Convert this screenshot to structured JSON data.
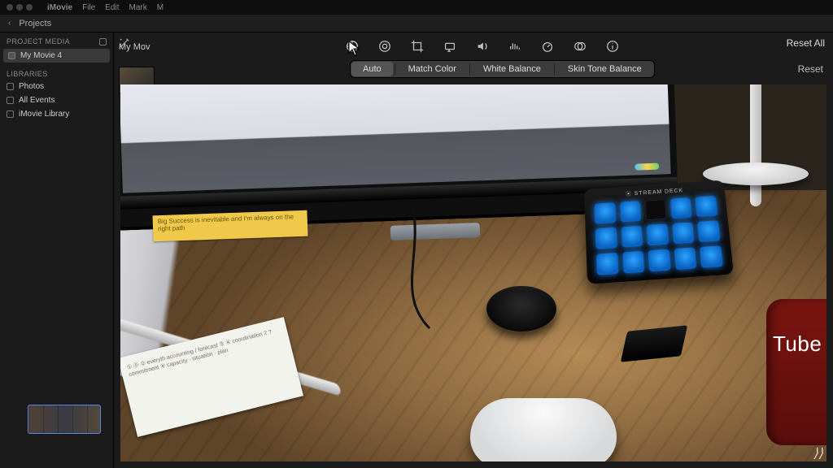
{
  "menubar": {
    "app": "iMovie",
    "items": [
      "File",
      "Edit",
      "Mark",
      "M"
    ]
  },
  "topbar": {
    "back": "‹",
    "projects": "Projects"
  },
  "library": {
    "projectMediaHeader": "PROJECT MEDIA",
    "projectName": "My Movie 4",
    "librariesHeader": "LIBRARIES",
    "photos": "Photos",
    "allEvents": "All Events",
    "imovieLibrary": "iMovie Library"
  },
  "browser": {
    "label": "My Mov"
  },
  "ccToolbar": {
    "icons": [
      "color-balance",
      "color-wheel",
      "crop",
      "stabilize",
      "audio",
      "eq",
      "speed",
      "effects",
      "info"
    ]
  },
  "segbar": {
    "auto": "Auto",
    "matchColor": "Match Color",
    "whiteBalance": "White Balance",
    "skinTone": "Skin Tone Balance"
  },
  "resetAll": "Reset All",
  "reset": "Reset",
  "scene": {
    "sticky": "Big Success is inevitable and\nI'm always on the right path",
    "notecard": "① ⓪ ② everyth\n   accounting / forecast\n⑤  ④  coordination\n   2 ?  commitment\n④ capacity · situation · plan",
    "streamdeckTitle": "⦿ STREAM DECK",
    "mugText": "Tube"
  },
  "cornerGlyph": "⟩⟩"
}
